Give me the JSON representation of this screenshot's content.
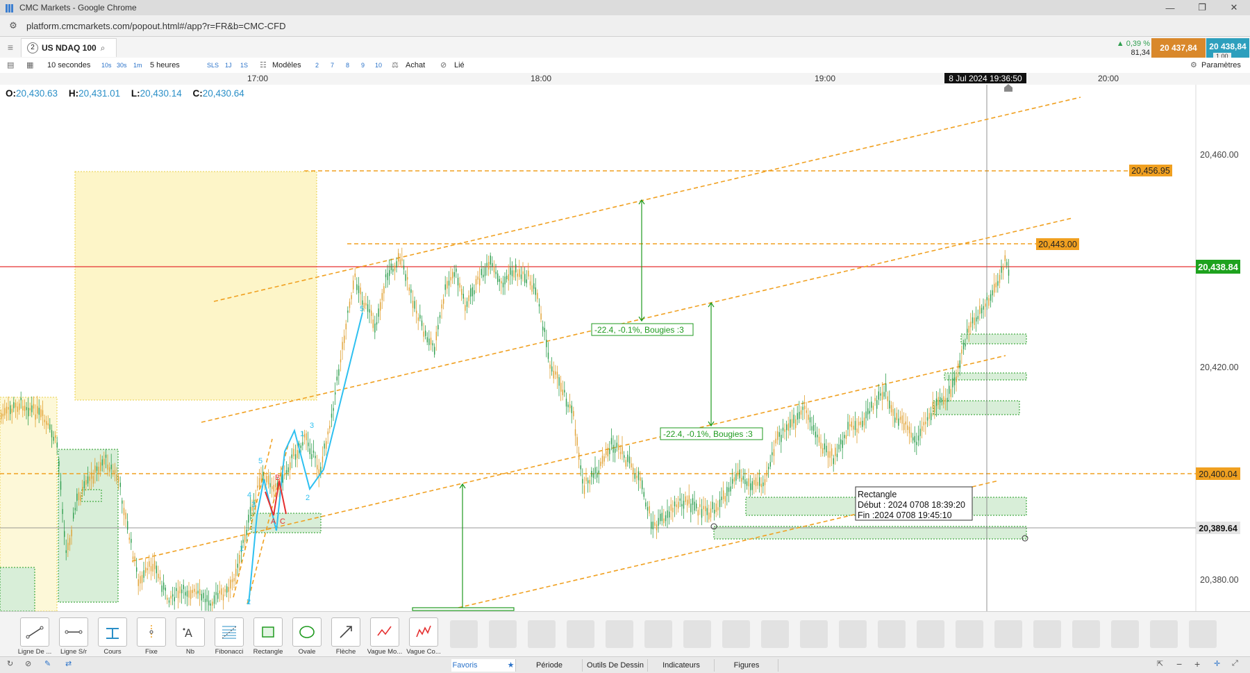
{
  "window": {
    "title": "CMC Markets - Google Chrome",
    "minimize": "—",
    "restore": "❐",
    "close": "✕"
  },
  "address": {
    "url": "platform.cmcmarkets.com/popout.html#/app?r=FR&b=CMC-CFD"
  },
  "instrument": {
    "index": "2",
    "name": "US NDAQ 100"
  },
  "prices": {
    "change_pct": "▲ 0,39 %",
    "change_pts": "81,34",
    "sell": "20 437,84",
    "buy": "20 438,84",
    "spread": "1.00"
  },
  "toolbar": {
    "interval": "10 secondes",
    "quick_1": "10s",
    "quick_2": "30s",
    "quick_3": "1m",
    "range": "5 heures",
    "r1": "SLS",
    "r2": "1J",
    "r3": "1S",
    "templates": "Modèles",
    "n1": "2",
    "n2": "7",
    "n3": "8",
    "n4": "9",
    "n5": "10",
    "buy": "Achat",
    "linked": "Lié",
    "settings": "Paramètres"
  },
  "time_axis": {
    "t1": "17:00",
    "t2": "18:00",
    "t3": "19:00",
    "t4": "20:00",
    "cursor": "8 Jul 2024 19:36:50"
  },
  "ohlc": {
    "o_label": "O:",
    "o": "20,430.63",
    "h_label": "H:",
    "h": "20,431.01",
    "l_label": "L:",
    "l": "20,430.14",
    "c_label": "C:",
    "c": "20,430.64"
  },
  "price_axis": {
    "p1": "20,460.00",
    "p2": "20,420.00",
    "p3": "20,380.00"
  },
  "price_tags": {
    "level1": "20,456.95",
    "level2": "20,443.00",
    "current": "20,438.84",
    "level3": "20,400.04",
    "crosshair": "20,389.64"
  },
  "annotations": {
    "measure1": "-22.4, -0.1%, Bougies :3",
    "measure2": "-22.4, -0.1%, Bougies :3"
  },
  "wave_labels": {
    "w1": "1",
    "w2": "2",
    "w3": "3",
    "w4": "4",
    "w5": "5",
    "wa": "A",
    "wb": "B",
    "wc": "C",
    "u1": "1",
    "u2": "2",
    "u3": "3",
    "u5": "5"
  },
  "tooltip": {
    "title": "Rectangle",
    "start": "Début : 2024 0708 18:39:20",
    "end": "Fin :2024 0708 19:45:10"
  },
  "tools": [
    {
      "label": "Ligne De ..."
    },
    {
      "label": "Ligne S/r"
    },
    {
      "label": "Cours"
    },
    {
      "label": "Fixe"
    },
    {
      "label": "Nb"
    },
    {
      "label": "Fibonacci"
    },
    {
      "label": "Rectangle"
    },
    {
      "label": "Ovale"
    },
    {
      "label": "Flèche"
    },
    {
      "label": "Vague Mo..."
    },
    {
      "label": "Vague Co..."
    }
  ],
  "tabs": {
    "favorites": "Favoris",
    "star": "★",
    "period": "Période",
    "drawing": "Outils De Dessin",
    "indicators": "Indicateurs",
    "figures": "Figures"
  },
  "zoom": {
    "minus": "−",
    "plus": "+"
  },
  "colors": {
    "accent": "#2a72c9",
    "orange": "#f0a020",
    "green": "#1ea21e",
    "red": "#e53030",
    "buy": "#2d9fbd",
    "sell": "#d9882b"
  }
}
